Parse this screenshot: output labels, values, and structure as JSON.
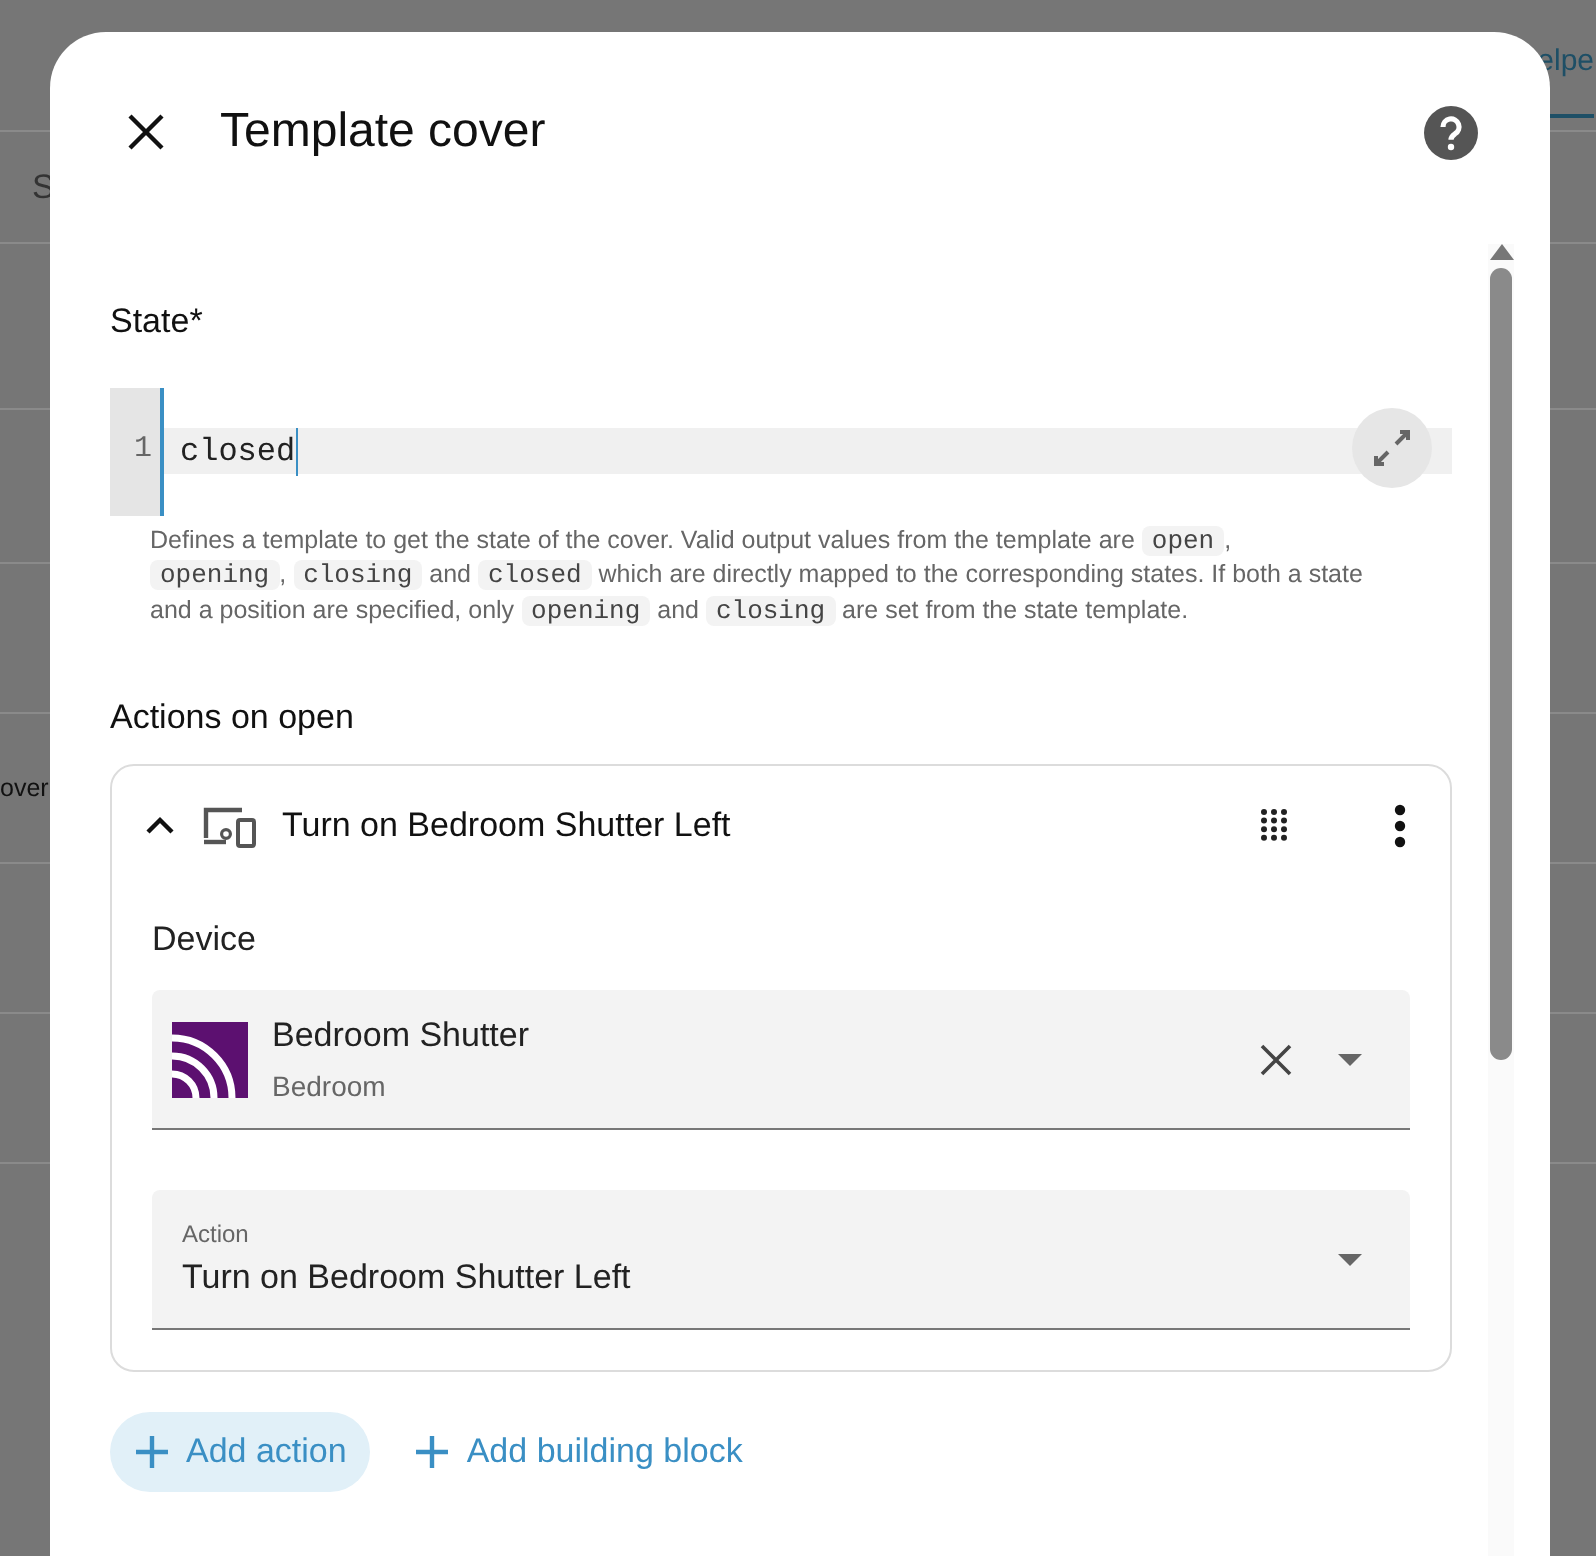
{
  "background": {
    "tab": "elpe",
    "column_header": "S",
    "row_text": "over"
  },
  "dialog": {
    "title": "Template cover",
    "state_field": {
      "label": "State*",
      "line_number": "1",
      "value": "closed",
      "help": [
        {
          "kind": "text",
          "text": "Defines a template to get the state of the cover. Valid output values from the template are "
        },
        {
          "kind": "code",
          "text": "open"
        },
        {
          "kind": "text",
          "text": ", "
        },
        {
          "kind": "code",
          "text": "opening"
        },
        {
          "kind": "text",
          "text": ", "
        },
        {
          "kind": "code",
          "text": "closing"
        },
        {
          "kind": "text",
          "text": " and "
        },
        {
          "kind": "code",
          "text": "closed"
        },
        {
          "kind": "text",
          "text": " which are directly mapped to the corresponding states. If both a state and a position are specified, only "
        },
        {
          "kind": "code",
          "text": "opening"
        },
        {
          "kind": "text",
          "text": " and "
        },
        {
          "kind": "code",
          "text": "closing"
        },
        {
          "kind": "text",
          "text": " are set from the state template."
        }
      ]
    },
    "actions_heading": "Actions on open",
    "action": {
      "title": "Turn on Bedroom Shutter Left",
      "expanded": true,
      "device_label": "Device",
      "device": {
        "name": "Bedroom Shutter",
        "area": "Bedroom"
      },
      "action_field": {
        "label": "Action",
        "value": "Turn on Bedroom Shutter Left"
      }
    },
    "buttons": [
      {
        "label": "Add action",
        "kind": "tonal"
      },
      {
        "label": "Add building block",
        "kind": "text"
      }
    ]
  }
}
